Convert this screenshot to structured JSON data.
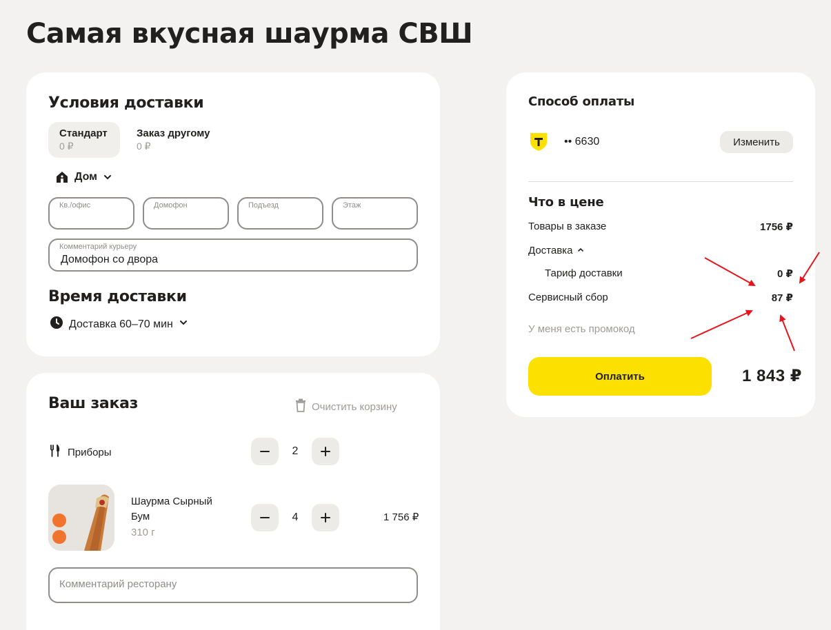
{
  "page": {
    "title": "Самая вкусная шаурма СВШ"
  },
  "delivery": {
    "heading": "Условия доставки",
    "tabs": [
      {
        "title": "Стандарт",
        "price": "0 ₽"
      },
      {
        "title": "Заказ другому",
        "price": "0 ₽"
      }
    ],
    "address_label": "Дом",
    "fields": {
      "apartment": "Кв./офис",
      "intercom": "Домофон",
      "entrance": "Подъезд",
      "floor": "Этаж",
      "comment_label": "Комментарий курьеру",
      "comment_value": "Домофон со двора"
    },
    "time_heading": "Время доставки",
    "time_value": "Доставка 60–70 мин"
  },
  "order": {
    "heading": "Ваш заказ",
    "clear_label": "Очистить корзину",
    "cutlery": {
      "label": "Приборы",
      "quantity": "2"
    },
    "items": [
      {
        "name": "Шаурма Сырный Бум",
        "weight": "310 г",
        "quantity": "4",
        "price": "1 756 ₽"
      }
    ],
    "restaurant_comment_placeholder": "Комментарий ресторану"
  },
  "payment": {
    "heading": "Способ оплаты",
    "card_mask": "•• 6630",
    "change_label": "Изменить",
    "breakdown_heading": "Что в цене",
    "items_label": "Товары в заказе",
    "items_value": "1756 ₽",
    "delivery_label": "Доставка",
    "tariff_label": "Тариф доставки",
    "tariff_value": "0 ₽",
    "service_label": "Сервисный сбор",
    "service_value": "87 ₽",
    "promo_label": "У меня есть промокод",
    "pay_label": "Оплатить",
    "total": "1 843 ₽"
  },
  "colors": {
    "background": "#f3f2f0",
    "pay_button": "#fce000",
    "annotation_arrow": "#e8141c",
    "badge": "#f0732e"
  },
  "icons": {
    "home": "home-icon",
    "chevron": "chevron-down-icon",
    "clock": "clock-icon",
    "trash": "trash-icon",
    "cutlery": "cutlery-icon",
    "bank": "tbank-shield-icon"
  }
}
